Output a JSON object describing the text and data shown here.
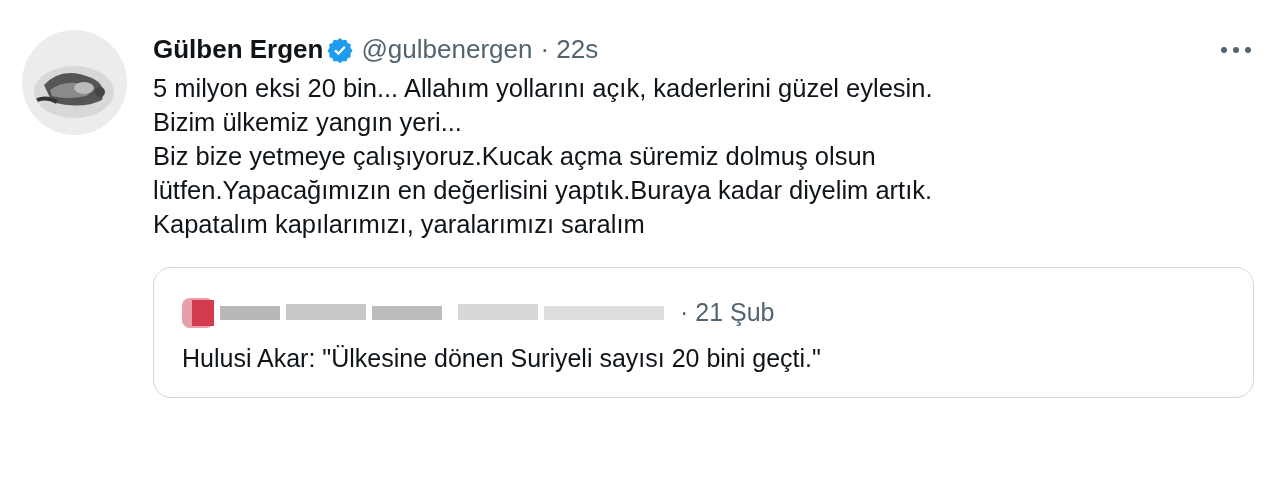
{
  "tweet": {
    "author": {
      "name": "Gülben Ergen",
      "verified": true,
      "handle": "@gulbenergen",
      "time": "· 22s"
    },
    "text": "5 milyon eksi 20 bin... Allahım yollarını açık, kaderlerini güzel eylesin.\nBizim ülkemiz yangın yeri...\nBiz bize yetmeye çalışıyoruz.Kucak açma süremiz dolmuş olsun\nlütfen.Yapacağımızın en değerlisini yaptık.Buraya kadar diyelim artık.\nKapatalım kapılarımızı, yaralarımızı saralım",
    "quote": {
      "time": "· 21 Şub",
      "text": "Hulusi Akar: \"Ülkesine dönen Suriyeli sayısı 20 bini geçti.\""
    }
  }
}
